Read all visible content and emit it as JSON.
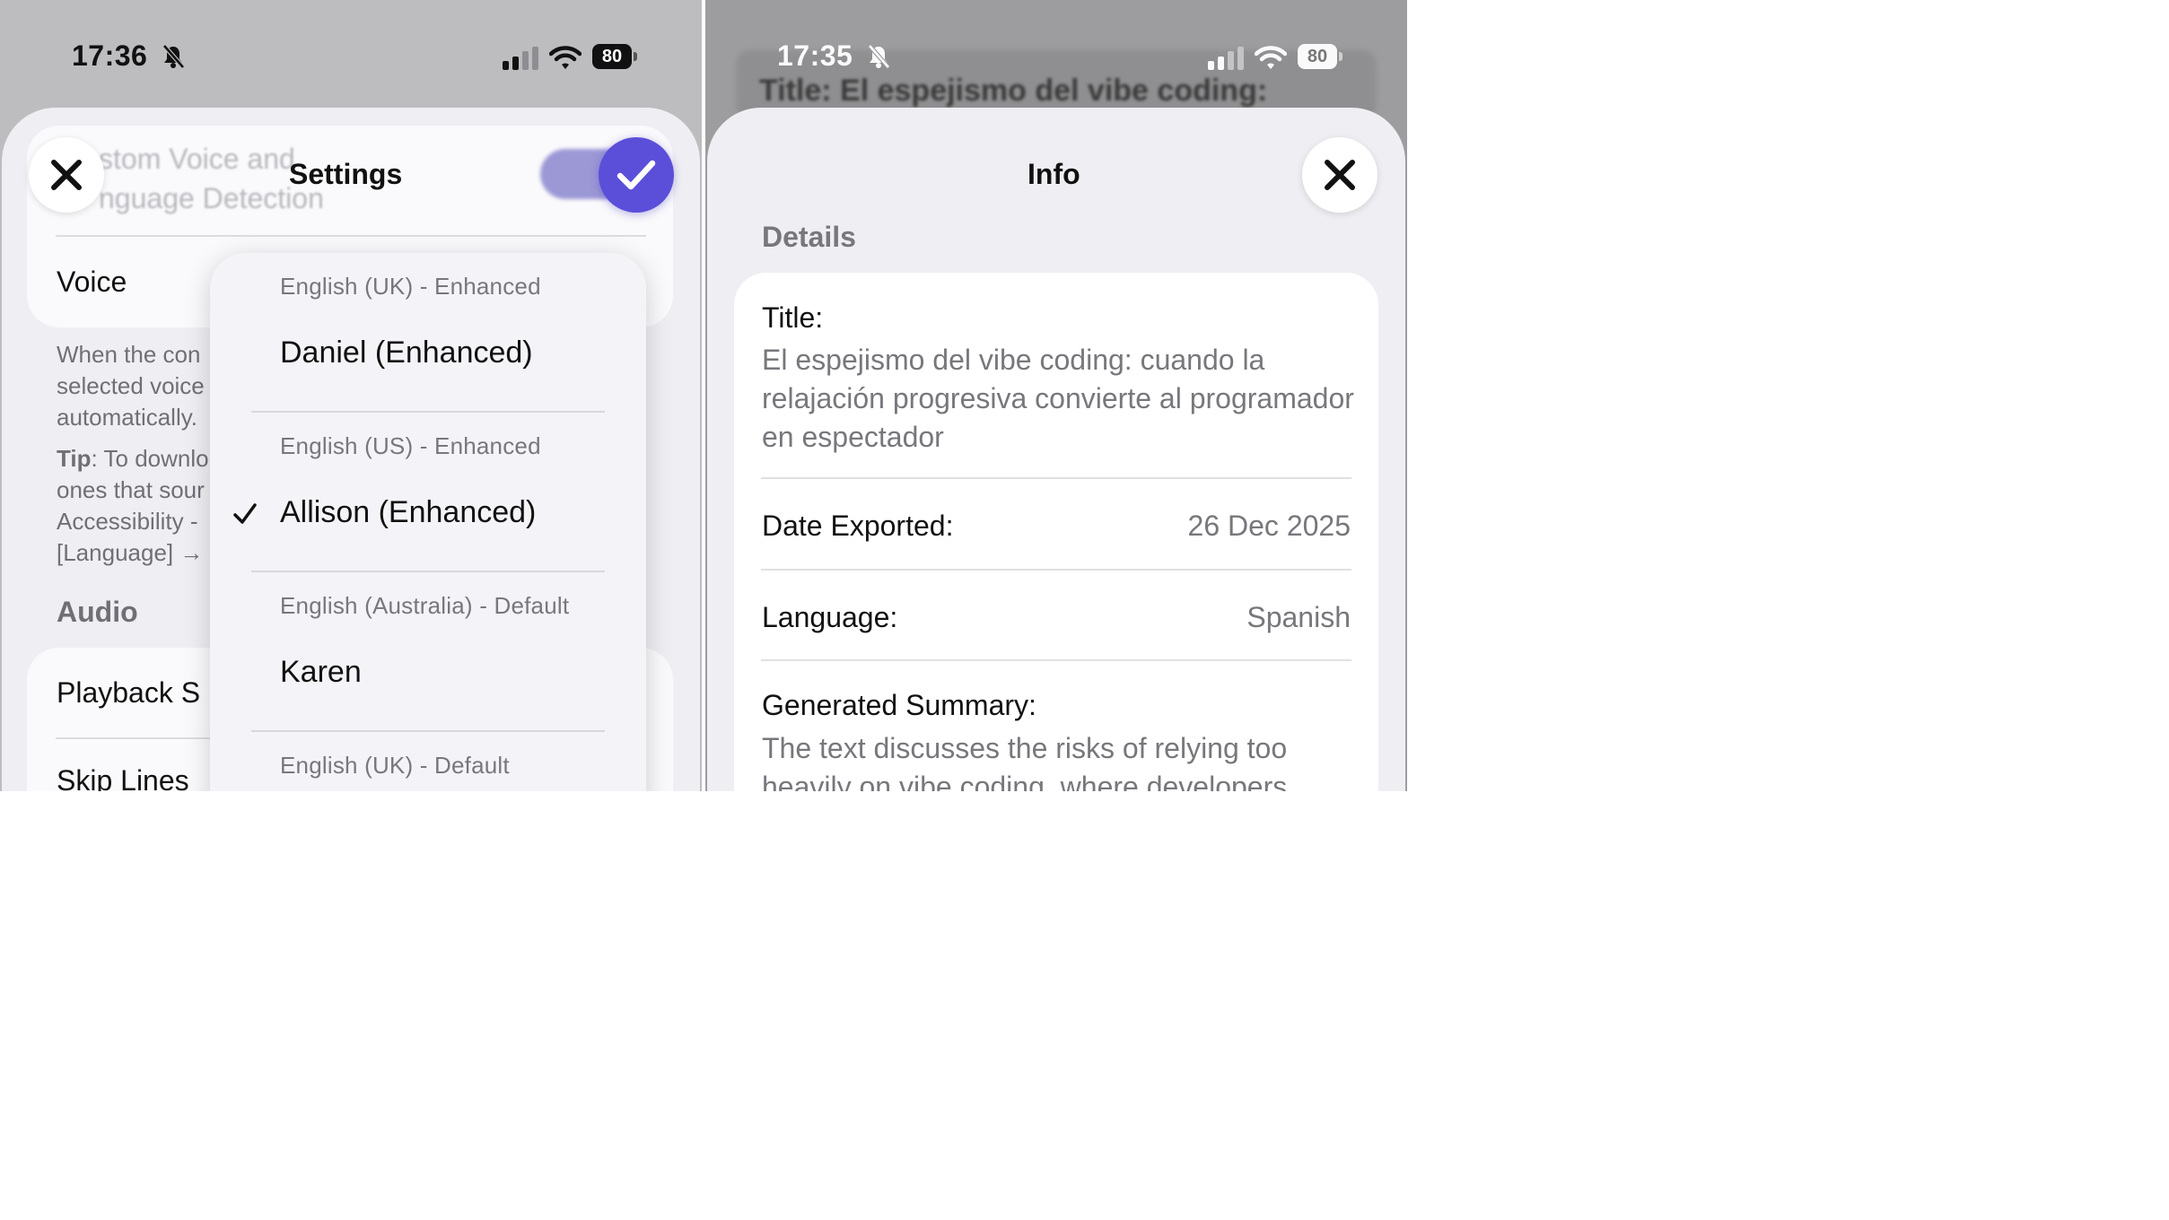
{
  "left": {
    "status": {
      "time": "17:36",
      "battery": "80"
    },
    "background_ghost": {
      "line1": "stom Voice and",
      "line2": "nguage Detection"
    },
    "nav": {
      "title": "Settings"
    },
    "voice_row": {
      "label": "Voice"
    },
    "footnote": {
      "line1": "When the con",
      "line2": "selected voice",
      "line3": "automatically."
    },
    "tip": {
      "bold": "Tip",
      "line1_rest": ": To downlo",
      "line2": "ones that sour",
      "line3": "Accessibility -",
      "line4": "[Language] →"
    },
    "audio": {
      "section": "Audio",
      "row1": "Playback S",
      "row2": "Skip Lines"
    },
    "voice_menu": {
      "items": [
        {
          "subtitle": "English (UK) - Enhanced",
          "name": "Daniel (Enhanced)",
          "selected": false
        },
        {
          "subtitle": "English (US) - Enhanced",
          "name": "Allison (Enhanced)",
          "selected": true
        },
        {
          "subtitle": "English (Australia) - Default",
          "name": "Karen",
          "selected": false
        },
        {
          "subtitle": "English (UK) - Default",
          "name": "",
          "selected": false
        }
      ]
    },
    "accent_color": "#5b4fd9"
  },
  "right": {
    "status": {
      "time": "17:35",
      "battery": "80"
    },
    "ghost_banner": "Title: El espejismo del vibe coding:",
    "nav": {
      "title": "Info"
    },
    "details": {
      "section": "Details",
      "title_label": "Title:",
      "title_value": "El espejismo del vibe coding: cuando la relajación progresiva convierte al programador en espectador",
      "date_label": "Date Exported:",
      "date_value": "26 Dec 2025",
      "language_label": "Language:",
      "language_value": "Spanish",
      "summary_label": "Generated Summary:",
      "summary_value": "The text discusses the risks of relying too heavily on vibe coding, where developers"
    }
  }
}
